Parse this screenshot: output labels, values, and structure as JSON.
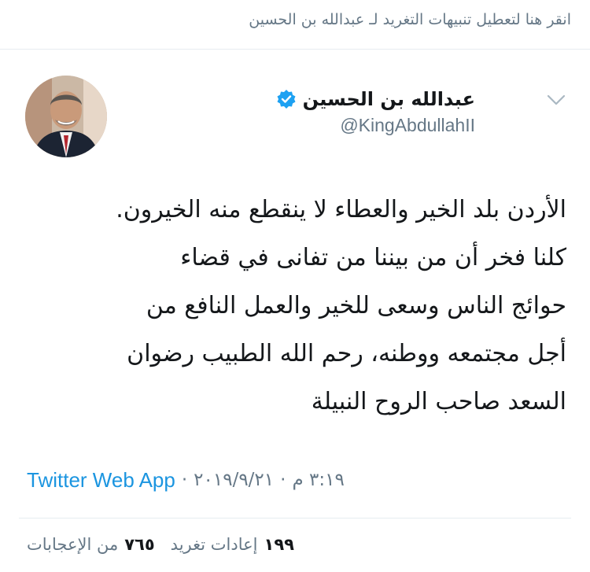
{
  "notification_banner": "انقر هنا لتعطيل تنبيهات التغريد لـ عبدالله بن الحسين",
  "author": {
    "display_name": "عبدالله بن الحسين",
    "handle": "@KingAbdullahII",
    "verified": true,
    "avatar_icon": "profile-photo"
  },
  "tweet": {
    "lines": [
      "الأردن بلد الخير والعطاء لا ينقطع منه الخيرون.",
      "كلنا فخر أن من بيننا من تفانى في قضاء",
      "حوائج الناس وسعى للخير والعمل النافع من",
      "أجل مجتمعه ووطنه، رحم الله الطبيب رضوان",
      "السعد صاحب الروح النبيلة"
    ]
  },
  "meta": {
    "time": "٣:١٩ م",
    "date": "٢٠١٩/٩/٢١",
    "separator": "·",
    "source": "Twitter Web App"
  },
  "stats": {
    "retweets_count": "١٩٩",
    "retweets_label": "إعادات تغريد",
    "likes_count": "٧٦٥",
    "likes_label": "من الإعجابات"
  },
  "colors": {
    "accent": "#1b95e0",
    "secondary_text": "#657786",
    "primary_text": "#14171a",
    "divider": "#e6ecf0",
    "verified_badge": "#1da1f2"
  }
}
